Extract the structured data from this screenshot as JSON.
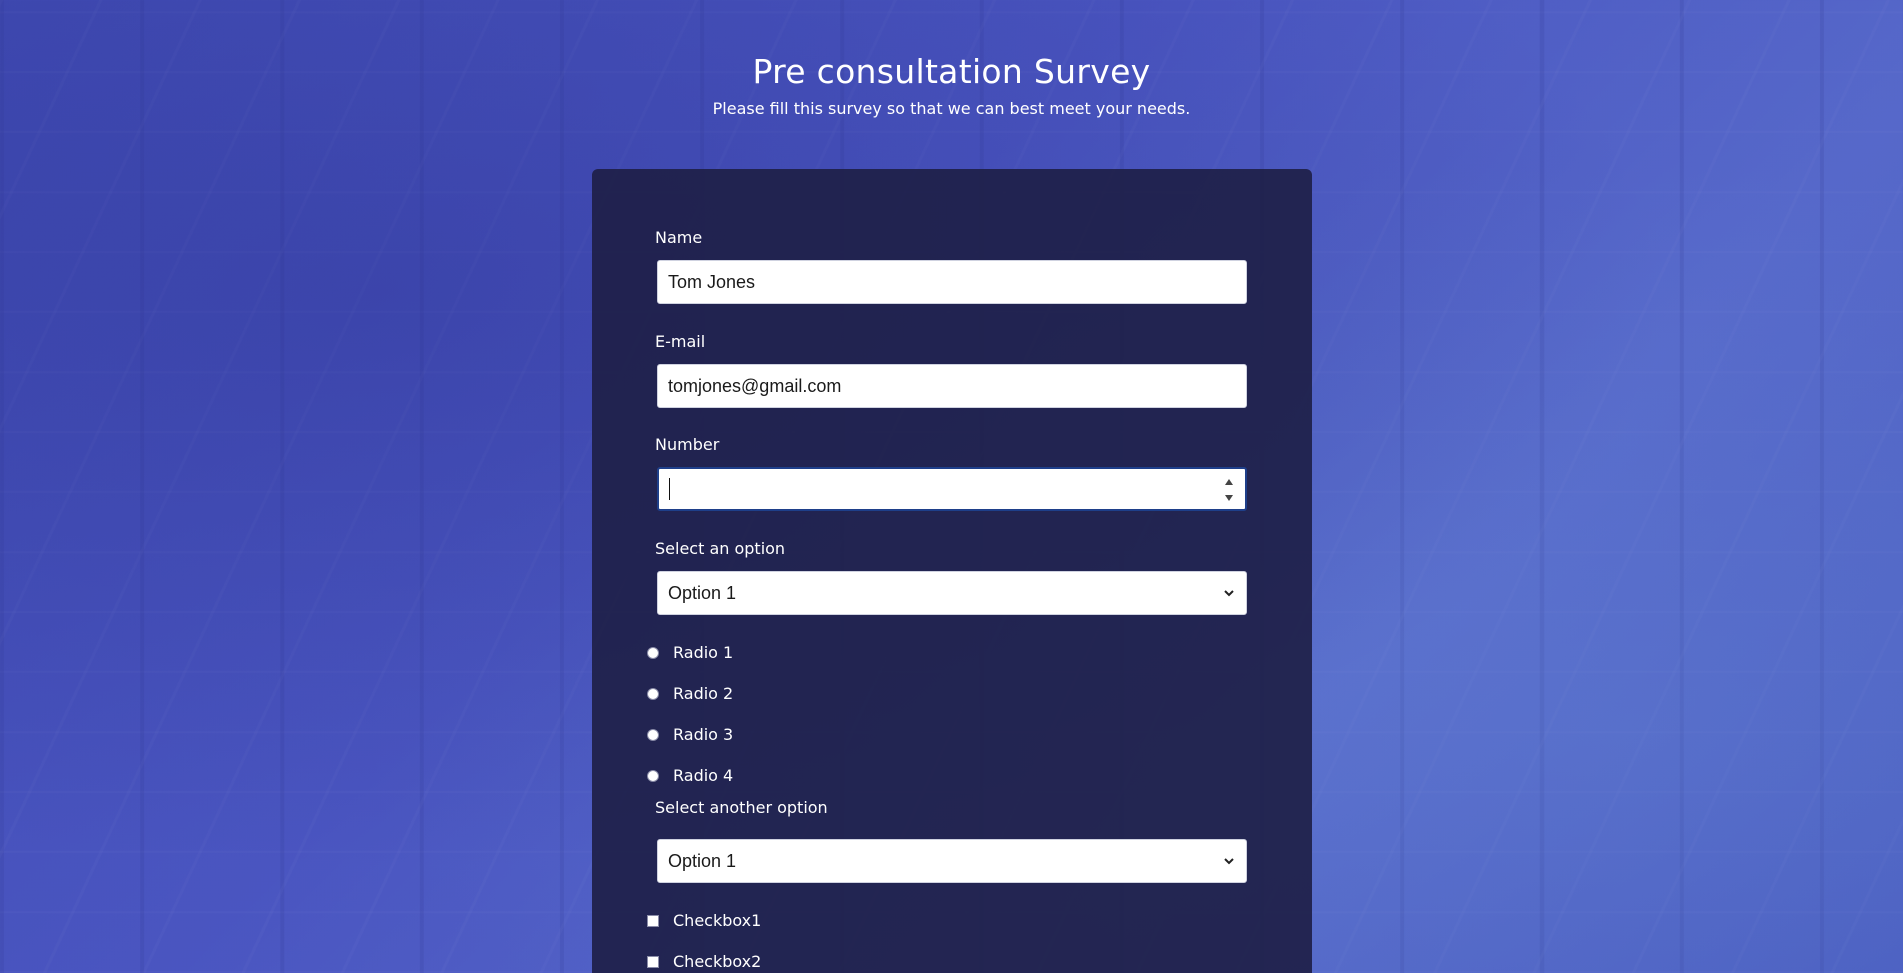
{
  "header": {
    "title": "Pre consultation Survey",
    "subtitle": "Please fill this survey so that we can best meet your needs."
  },
  "form": {
    "name": {
      "label": "Name",
      "value": "Tom Jones"
    },
    "email": {
      "label": "E-mail",
      "value": "tomjones@gmail.com"
    },
    "number": {
      "label": "Number",
      "value": ""
    },
    "select1": {
      "label": "Select an option",
      "value": "Option 1"
    },
    "radios": [
      "Radio 1",
      "Radio 2",
      "Radio 3",
      "Radio 4"
    ],
    "select2": {
      "label": "Select another option",
      "value": "Option 1"
    },
    "checkboxes": [
      "Checkbox1",
      "Checkbox2"
    ]
  },
  "icons": {
    "select_chevron": "chevron-down-icon",
    "number_spinner": "spinner-icon"
  },
  "colors": {
    "card_background": "#1e2048",
    "page_accent": "#4a56b8",
    "focus_border": "#1e3f8a"
  }
}
